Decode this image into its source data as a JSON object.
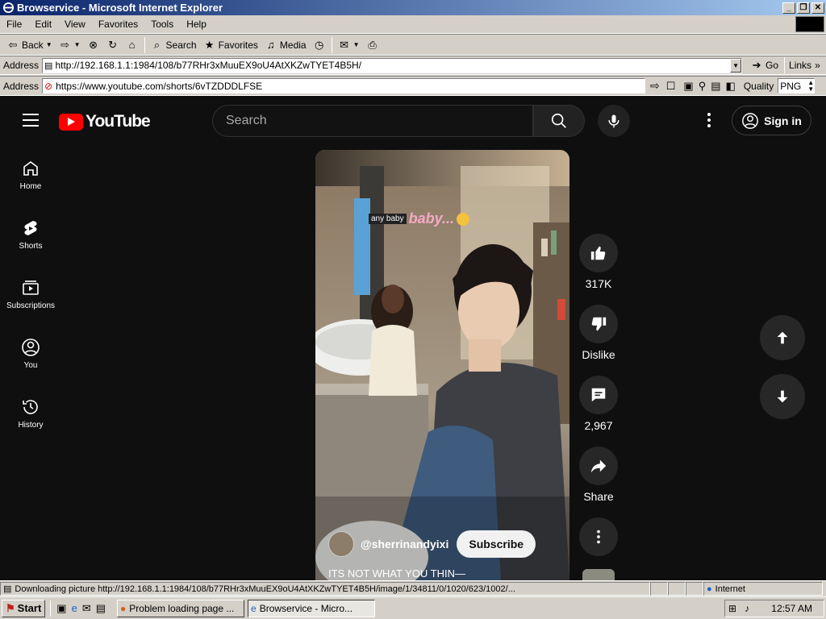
{
  "window": {
    "title": "Browservice - Microsoft Internet Explorer"
  },
  "menu": [
    "File",
    "Edit",
    "View",
    "Favorites",
    "Tools",
    "Help"
  ],
  "toolbar": {
    "back": "Back",
    "search": "Search",
    "favorites": "Favorites",
    "media": "Media"
  },
  "ie_address": {
    "label": "Address",
    "url": "http://192.168.1.1:1984/108/b77RHr3xMuuEX9oU4AtXKZwTYET4B5H/",
    "go": "Go",
    "links": "Links"
  },
  "bs_address": {
    "label": "Address",
    "url": "https://www.youtube.com/shorts/6vTZDDDLFSE",
    "quality_label": "Quality",
    "quality_value": "PNG"
  },
  "youtube": {
    "logo_text": "YouTube",
    "search_placeholder": "Search",
    "sign_in": "Sign in",
    "sidebar": [
      {
        "label": "Home",
        "icon": "home-icon"
      },
      {
        "label": "Shorts",
        "icon": "shorts-icon"
      },
      {
        "label": "Subscriptions",
        "icon": "subscriptions-icon"
      },
      {
        "label": "You",
        "icon": "you-icon"
      },
      {
        "label": "History",
        "icon": "history-icon"
      }
    ],
    "short": {
      "caption_tag": "any baby",
      "caption_text": "baby...",
      "channel": "@sherrinandyixi",
      "subscribe": "Subscribe",
      "title": "ITS NOT WHAT YOU THIN—"
    },
    "actions": {
      "likes": "317K",
      "dislike": "Dislike",
      "comments": "2,967",
      "share": "Share"
    }
  },
  "status": {
    "text": "Downloading picture http://192.168.1.1:1984/108/b77RHr3xMuuEX9oU4AtXKZwTYET4B5H/image/1/34811/0/1020/623/1002/...",
    "zone": "Internet"
  },
  "taskbar": {
    "start": "Start",
    "tasks": [
      "Problem loading page ...",
      "Browservice - Micro..."
    ],
    "clock": "12:57 AM"
  }
}
